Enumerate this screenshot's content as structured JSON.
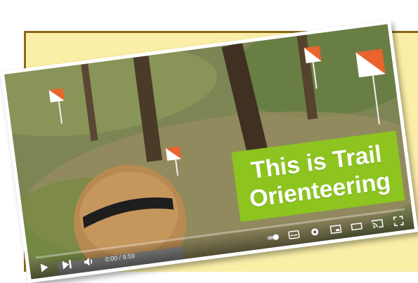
{
  "video": {
    "title_lines": [
      "This is Trail",
      "Orienteering"
    ],
    "time_display": "0:00 / 9:59"
  },
  "colors": {
    "frame_background": "#fbefa7",
    "frame_border": "#8b6a1a",
    "title_box": "#8dc420",
    "title_text": "#ffffff",
    "control_flag_orange": "#e8642c"
  },
  "controls": {
    "left": [
      "play-icon",
      "next-icon",
      "volume-icon"
    ],
    "right": [
      "autoplay-toggle",
      "subtitles-icon",
      "settings-icon",
      "miniplayer-icon",
      "theater-icon",
      "cast-icon",
      "fullscreen-icon"
    ]
  }
}
